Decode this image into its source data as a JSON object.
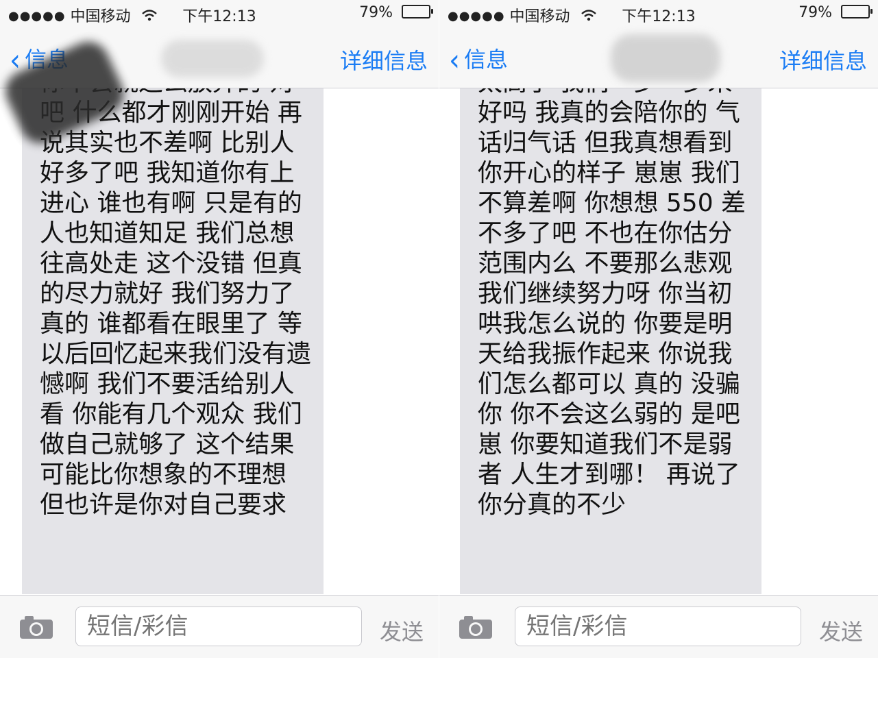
{
  "screens": [
    {
      "statusbar": {
        "signal": "●●●●●",
        "carrier": "中国移动",
        "time": "下午12:13",
        "battery": "79%",
        "battery_level": 0.79
      },
      "nav": {
        "back": "信息",
        "detail": "详细信息"
      },
      "message": "你不会就这么放弃的 对吧 什么都才刚刚开始 再说其实也不差啊 比别人好多了吧 我知道你有上进心 谁也有啊 只是有的人也知道知足 我们总想往高处走 这个没错 但真的尽力就好 我们努力了 真的 谁都看在眼里了 等以后回忆起来我们没有遗憾啊 我们不要活给别人看 你能有几个观众 我们做自己就够了 这个结果可能比你想象的不理想 但也许是你对自己要求",
      "input": {
        "placeholder": "短信/彩信",
        "send": "发送"
      }
    },
    {
      "statusbar": {
        "signal": "●●●●●",
        "carrier": "中国移动",
        "time": "下午12:13",
        "battery": "79%",
        "battery_level": 0.79
      },
      "nav": {
        "back": "信息",
        "detail": "详细信息"
      },
      "message": "太高了 我们一步一步来 好吗 我真的会陪你的 气话归气话 但我真想看到你开心的样子 崽崽 我们不算差啊 你想想 550 差不多了吧 不也在你估分范围内么 不要那么悲观 我们继续努力呀 你当初哄我怎么说的 你要是明天给我振作起来 你说我们怎么都可以 真的 没骗你 你不会这么弱的 是吧崽 你要知道我们不是弱者 人生才到哪！ 再说了 你分真的不少",
      "input": {
        "placeholder": "短信/彩信",
        "send": "发送"
      }
    }
  ]
}
